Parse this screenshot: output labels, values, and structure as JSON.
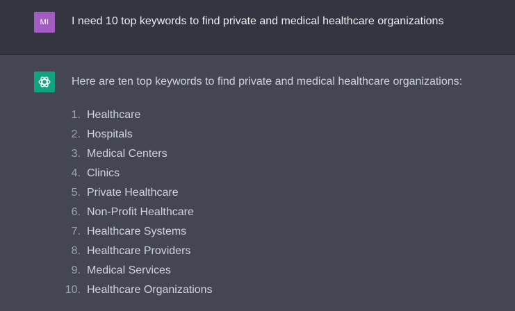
{
  "user_message": {
    "avatar_initials": "MI",
    "avatar_color": "#a35cc2",
    "text": "I need 10 top keywords to find private and medical healthcare organizations"
  },
  "assistant_message": {
    "avatar_icon": "openai-logo-icon",
    "avatar_color": "#10a37f",
    "intro": "Here are ten top keywords to find private and medical healthcare organizations:",
    "items": [
      {
        "num": "1.",
        "text": "Healthcare"
      },
      {
        "num": "2.",
        "text": "Hospitals"
      },
      {
        "num": "3.",
        "text": "Medical Centers"
      },
      {
        "num": "4.",
        "text": "Clinics"
      },
      {
        "num": "5.",
        "text": "Private Healthcare"
      },
      {
        "num": "6.",
        "text": "Non-Profit Healthcare"
      },
      {
        "num": "7.",
        "text": "Healthcare Systems"
      },
      {
        "num": "8.",
        "text": "Healthcare Providers"
      },
      {
        "num": "9.",
        "text": "Medical Services"
      },
      {
        "num": "10.",
        "text": "Healthcare Organizations"
      }
    ]
  }
}
